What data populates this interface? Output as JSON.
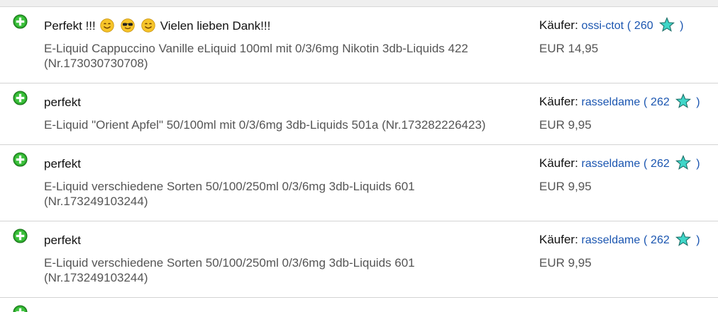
{
  "feedback": [
    {
      "comment_text": "Perfekt !!!",
      "comment_suffix": "Vielen lieben Dank!!!",
      "emojis": [
        "smiling-face-emoji",
        "sunglasses-face-emoji",
        "smiling-face-emoji"
      ],
      "item": "E-Liquid Cappuccino Vanille eLiquid 100ml mit 0/3/6mg Nikotin 3db-Liquids 422 (Nr.173030730708)",
      "buyer_label": "Käufer:",
      "buyer_name": "ossi-ctot",
      "buyer_score": "260",
      "price": "EUR 14,95"
    },
    {
      "comment_text": "perfekt",
      "comment_suffix": "",
      "emojis": [],
      "item": "E-Liquid \"Orient Apfel\" 50/100ml mit 0/3/6mg 3db-Liquids 501a (Nr.173282226423)",
      "buyer_label": "Käufer:",
      "buyer_name": "rasseldame",
      "buyer_score": "262",
      "price": "EUR 9,95"
    },
    {
      "comment_text": "perfekt",
      "comment_suffix": "",
      "emojis": [],
      "item": "E-Liquid verschiedene Sorten 50/100/250ml 0/3/6mg 3db-Liquids 601 (Nr.173249103244)",
      "buyer_label": "Käufer:",
      "buyer_name": "rasseldame",
      "buyer_score": "262",
      "price": "EUR 9,95"
    },
    {
      "comment_text": "perfekt",
      "comment_suffix": "",
      "emojis": [],
      "item": "E-Liquid verschiedene Sorten 50/100/250ml 0/3/6mg 3db-Liquids 601 (Nr.173249103244)",
      "buyer_label": "Käufer:",
      "buyer_name": "rasseldame",
      "buyer_score": "262",
      "price": "EUR 9,95"
    }
  ],
  "colors": {
    "positive_green": "#2aa82a",
    "link_blue": "#1a55b0",
    "star_teal": "#3fd6c8",
    "divider": "#d3d3d3"
  }
}
